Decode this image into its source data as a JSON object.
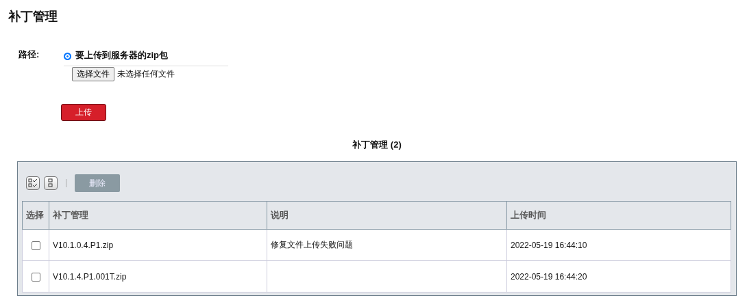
{
  "page_title": "补丁管理",
  "form": {
    "label": "路径:",
    "option": {
      "label": "要上传到服务器的zip包",
      "selected": true
    },
    "file_button": "选择文件",
    "file_status": "未选择任何文件",
    "upload_button": "上传"
  },
  "table_title": "补丁管理 (2)",
  "toolbar": {
    "delete_button": "删除",
    "delete_disabled": true
  },
  "table": {
    "columns": [
      "选择",
      "补丁管理",
      "说明",
      "上传时间"
    ],
    "rows": [
      {
        "checked": false,
        "name": "V10.1.0.4.P1.zip",
        "description": "修复文件上传失败问题",
        "time": "2022-05-19 16:44:10"
      },
      {
        "checked": false,
        "name": "V10.1.4.P1.001T.zip",
        "time": "2022-05-19 16:44:20"
      }
    ]
  }
}
